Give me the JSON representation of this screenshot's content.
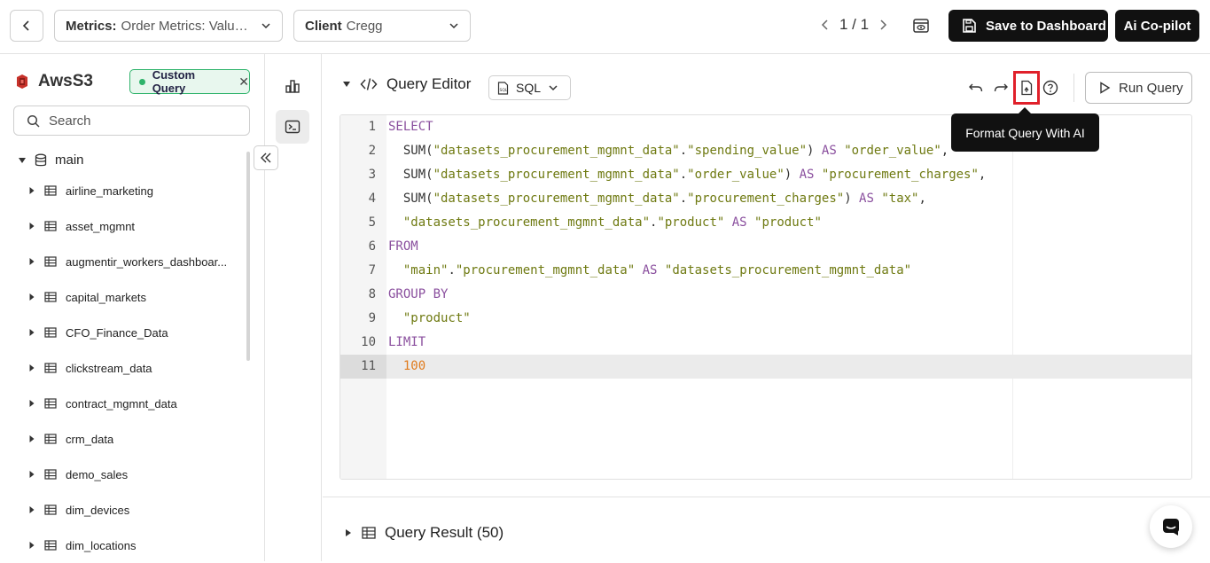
{
  "topbar": {
    "metrics_label": "Metrics:",
    "metrics_value": "Order Metrics: Value…",
    "client_label": "Client",
    "client_value": "Cregg",
    "pager_text": "1 / 1",
    "save_label": "Save to Dashboard",
    "copilot_label": "Ai Co-pilot"
  },
  "sidebar": {
    "datasource_name": "AwsS3",
    "badge_label": "Custom Query",
    "search_placeholder": "Search",
    "root_label": "main",
    "items": [
      {
        "label": "airline_marketing"
      },
      {
        "label": "asset_mgmnt"
      },
      {
        "label": "augmentir_workers_dashboar..."
      },
      {
        "label": "capital_markets"
      },
      {
        "label": "CFO_Finance_Data"
      },
      {
        "label": "clickstream_data"
      },
      {
        "label": "contract_mgmnt_data"
      },
      {
        "label": "crm_data"
      },
      {
        "label": "demo_sales"
      },
      {
        "label": "dim_devices"
      },
      {
        "label": "dim_locations"
      }
    ]
  },
  "editor": {
    "title": "Query Editor",
    "language": "SQL",
    "run_label": "Run Query",
    "tooltip": "Format Query With AI",
    "lines": [
      {
        "num": "1",
        "tokens": [
          {
            "t": "kw",
            "v": "SELECT"
          }
        ]
      },
      {
        "num": "2",
        "tokens": [
          {
            "t": "p",
            "v": "  SUM("
          },
          {
            "t": "str",
            "v": "\"datasets_procurement_mgmnt_data\""
          },
          {
            "t": "p",
            "v": "."
          },
          {
            "t": "str",
            "v": "\"spending_value\""
          },
          {
            "t": "p",
            "v": ") "
          },
          {
            "t": "kw",
            "v": "AS"
          },
          {
            "t": "p",
            "v": " "
          },
          {
            "t": "str",
            "v": "\"order_value\""
          },
          {
            "t": "p",
            "v": ","
          }
        ]
      },
      {
        "num": "3",
        "tokens": [
          {
            "t": "p",
            "v": "  SUM("
          },
          {
            "t": "str",
            "v": "\"datasets_procurement_mgmnt_data\""
          },
          {
            "t": "p",
            "v": "."
          },
          {
            "t": "str",
            "v": "\"order_value\""
          },
          {
            "t": "p",
            "v": ") "
          },
          {
            "t": "kw",
            "v": "AS"
          },
          {
            "t": "p",
            "v": " "
          },
          {
            "t": "str",
            "v": "\"procurement_charges\""
          },
          {
            "t": "p",
            "v": ","
          }
        ]
      },
      {
        "num": "4",
        "tokens": [
          {
            "t": "p",
            "v": "  SUM("
          },
          {
            "t": "str",
            "v": "\"datasets_procurement_mgmnt_data\""
          },
          {
            "t": "p",
            "v": "."
          },
          {
            "t": "str",
            "v": "\"procurement_charges\""
          },
          {
            "t": "p",
            "v": ") "
          },
          {
            "t": "kw",
            "v": "AS"
          },
          {
            "t": "p",
            "v": " "
          },
          {
            "t": "str",
            "v": "\"tax\""
          },
          {
            "t": "p",
            "v": ","
          }
        ]
      },
      {
        "num": "5",
        "tokens": [
          {
            "t": "p",
            "v": "  "
          },
          {
            "t": "str",
            "v": "\"datasets_procurement_mgmnt_data\""
          },
          {
            "t": "p",
            "v": "."
          },
          {
            "t": "str",
            "v": "\"product\""
          },
          {
            "t": "p",
            "v": " "
          },
          {
            "t": "kw",
            "v": "AS"
          },
          {
            "t": "p",
            "v": " "
          },
          {
            "t": "str",
            "v": "\"product\""
          }
        ]
      },
      {
        "num": "6",
        "tokens": [
          {
            "t": "kw",
            "v": "FROM"
          }
        ]
      },
      {
        "num": "7",
        "tokens": [
          {
            "t": "p",
            "v": "  "
          },
          {
            "t": "str",
            "v": "\"main\""
          },
          {
            "t": "p",
            "v": "."
          },
          {
            "t": "str",
            "v": "\"procurement_mgmnt_data\""
          },
          {
            "t": "p",
            "v": " "
          },
          {
            "t": "kw",
            "v": "AS"
          },
          {
            "t": "p",
            "v": " "
          },
          {
            "t": "str",
            "v": "\"datasets_procurement_mgmnt_data\""
          }
        ]
      },
      {
        "num": "8",
        "tokens": [
          {
            "t": "kw",
            "v": "GROUP BY"
          }
        ]
      },
      {
        "num": "9",
        "tokens": [
          {
            "t": "p",
            "v": "  "
          },
          {
            "t": "str",
            "v": "\"product\""
          }
        ]
      },
      {
        "num": "10",
        "tokens": [
          {
            "t": "kw",
            "v": "LIMIT"
          }
        ]
      },
      {
        "num": "11",
        "tokens": [
          {
            "t": "p",
            "v": "  "
          },
          {
            "t": "num",
            "v": "100"
          }
        ],
        "active": true
      }
    ]
  },
  "result": {
    "title": "Query Result (50)"
  },
  "colors": {
    "keyword": "#8a4f9e",
    "string": "#6f7a12",
    "number": "#e07b1d",
    "badge_green": "#2fb36b",
    "highlight_red": "#e0202a"
  }
}
